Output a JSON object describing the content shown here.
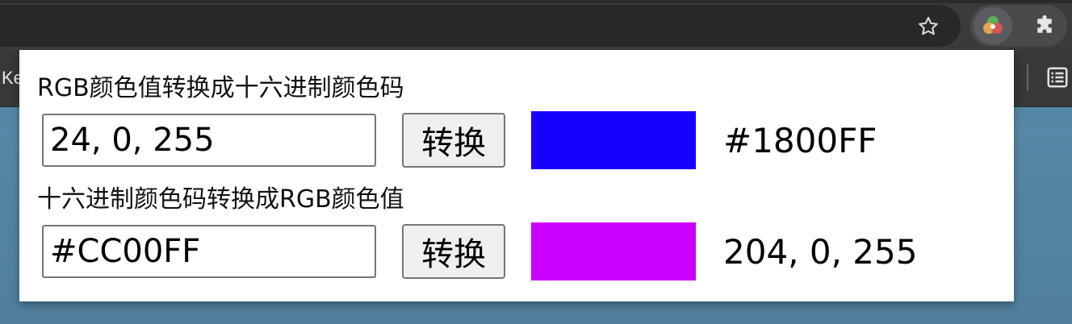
{
  "browser": {
    "bookmark_partial_label": "Ke",
    "icons": {
      "star": "bookmark-star-icon",
      "extension": "color-converter-extension-icon",
      "puzzle": "extensions-puzzle-icon",
      "reading_list": "reading-list-icon"
    }
  },
  "popup": {
    "rgb_to_hex": {
      "heading": "RGB颜色值转换成十六进制颜色码",
      "input_value": "24, 0, 255",
      "button_label": "转换",
      "swatch_color": "#1800FF",
      "result": "#1800FF"
    },
    "hex_to_rgb": {
      "heading": "十六进制颜色码转换成RGB颜色值",
      "input_value": "#CC00FF",
      "button_label": "转换",
      "swatch_color": "#CC00FF",
      "result": "204, 0, 255"
    }
  }
}
